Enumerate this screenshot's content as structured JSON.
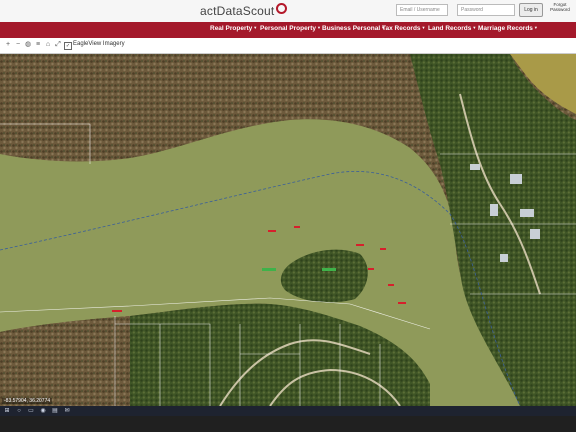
{
  "header": {
    "brand": "actDataScout",
    "email_placeholder": "Email / Username",
    "password_placeholder": "Password",
    "login_label": "Log in",
    "forgot_label": "Forgot Password"
  },
  "nav": {
    "items": [
      {
        "label": "Real Property"
      },
      {
        "label": "Personal Property"
      },
      {
        "label": "Business Personal"
      },
      {
        "label": "Tax Records"
      },
      {
        "label": "Land Records"
      },
      {
        "label": "Marriage Records"
      }
    ]
  },
  "toolbar": {
    "layer_label": "EagleView Imagery",
    "layer_checked": true,
    "icons": [
      "zoom-in-icon",
      "zoom-out-icon",
      "globe-icon",
      "layers-icon",
      "home-icon",
      "measure-icon"
    ]
  },
  "map": {
    "coordinate_readout": "-83.57904, 36.20774",
    "water_color": "#8f9a5a",
    "parcel_line_color": "#ffffff",
    "marker_color": "#d6202c"
  },
  "colors": {
    "brand_red": "#a4192b",
    "taskbar": "#1e2330"
  }
}
